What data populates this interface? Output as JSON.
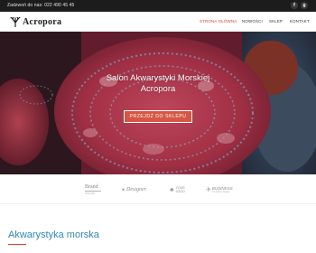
{
  "topbar": {
    "phone_text": "Zadzwoń do nas: 022 490 45 45",
    "social": [
      "facebook-icon",
      "google-plus-icon"
    ]
  },
  "header": {
    "logo_text": "Acropora",
    "nav": [
      {
        "label": "STRONA GŁÓWNA",
        "active": true
      },
      {
        "label": "NOWOŚCI",
        "active": false
      },
      {
        "label": "SKLEP",
        "active": false
      },
      {
        "label": "KONTAKT",
        "active": false
      }
    ]
  },
  "hero": {
    "title_line1": "Salon Akwarystyki Morskiej",
    "title_line2": "Acropora",
    "button_label": "PRZEJDŹ DO SKLEPU"
  },
  "brands": [
    {
      "name": "Brand",
      "sub": "TAGLINE"
    },
    {
      "name": "Designer",
      "sub": ""
    },
    {
      "name": "YOUR LOGO",
      "sub": ""
    },
    {
      "name": "BUSINESS",
      "sub": "Company slogan"
    }
  ],
  "section": {
    "title": "Akwarystyka morska"
  },
  "colors": {
    "accent": "#e2402a",
    "heading_blue": "#2c8bc9",
    "topbar": "#1c1c1c"
  }
}
